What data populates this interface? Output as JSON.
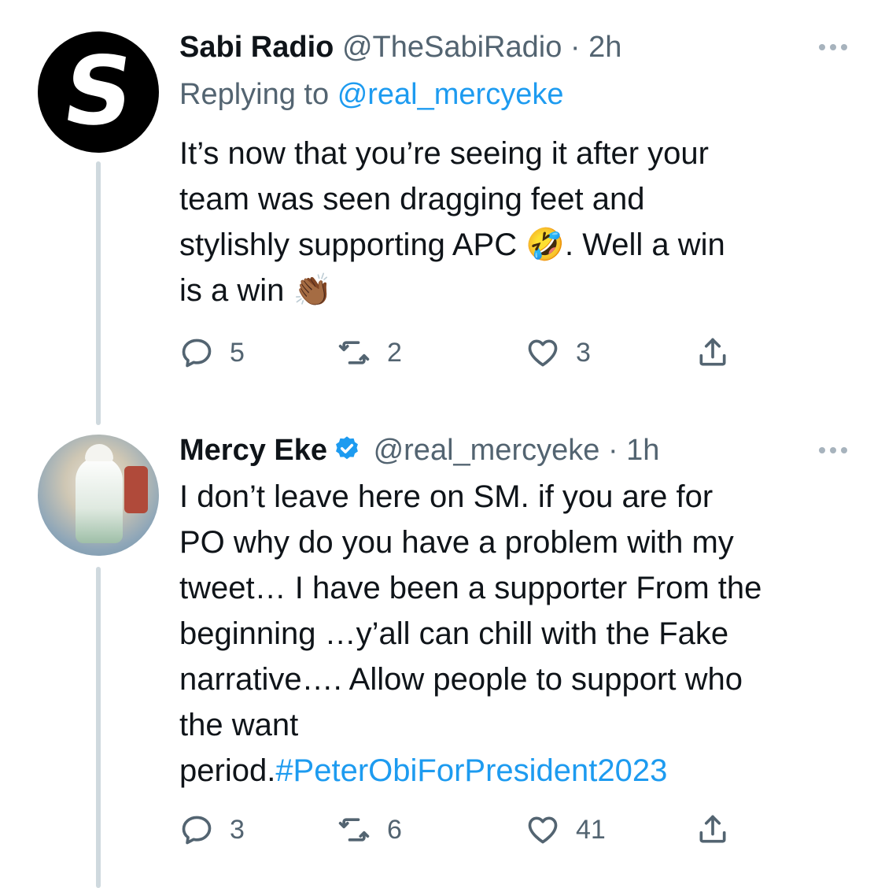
{
  "tweets": [
    {
      "name": "Sabi Radio",
      "handle": "@TheSabiRadio",
      "separator": "·",
      "time": "2h",
      "reply_prefix": "Replying to",
      "reply_to": "@real_mercyeke",
      "avatar_letter": "S",
      "text_lines": [
        "It’s now that you’re seeing it after your",
        "team was seen dragging feet and",
        "stylishly supporting APC 🤣. Well a win",
        "is a win 👏🏾"
      ],
      "reply_count": "5",
      "retweet_count": "2",
      "like_count": "3"
    },
    {
      "name": "Mercy Eke",
      "handle": "@real_mercyeke",
      "separator": "·",
      "time": "1h",
      "verified": true,
      "text_lines": [
        "I don’t leave here  on SM. if you are for",
        "PO why do you have a problem with my",
        "tweet… I have been a supporter From the",
        "beginning …y’all can chill with the Fake",
        "narrative…. Allow people to support who",
        "the want"
      ],
      "text_last_prefix": "period.",
      "hashtag": "#PeterObiForPresident2023",
      "reply_count": "3",
      "retweet_count": "6",
      "like_count": "41"
    }
  ],
  "icons": {
    "reply": "reply-icon",
    "retweet": "retweet-icon",
    "like": "heart-icon",
    "share": "share-icon",
    "more": "more-icon",
    "verified": "verified-badge-icon"
  },
  "colors": {
    "link": "#1d9bf0",
    "muted": "#536471",
    "text": "#0f1419",
    "thread_line": "#cfd9de"
  }
}
